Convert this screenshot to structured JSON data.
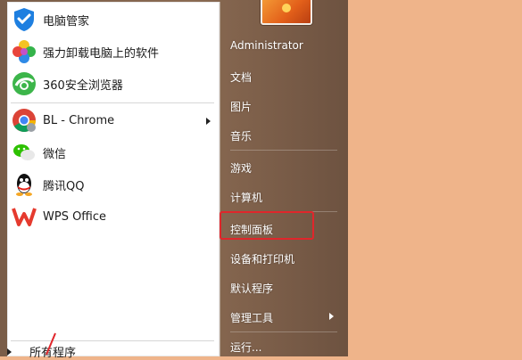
{
  "start_menu": {
    "apps": [
      {
        "name": "电脑管家",
        "icon": "tencent-pc-manager-icon"
      },
      {
        "name": "强力卸载电脑上的软件",
        "icon": "uninstaller-icon"
      },
      {
        "name": "360安全浏览器",
        "icon": "360-browser-icon"
      },
      {
        "name": "BL - Chrome",
        "icon": "chrome-icon"
      },
      {
        "name": "微信",
        "icon": "wechat-icon"
      },
      {
        "name": "腾讯QQ",
        "icon": "qq-icon"
      },
      {
        "name": "WPS Office",
        "icon": "wps-icon"
      }
    ],
    "all_programs": "所有程序",
    "right": {
      "user": "Administrator",
      "items": [
        "文档",
        "图片",
        "音乐",
        "游戏",
        "计算机",
        "控制面板",
        "设备和打印机",
        "默认程序",
        "管理工具",
        "运行..."
      ]
    },
    "highlight_color": "#e0262b"
  }
}
